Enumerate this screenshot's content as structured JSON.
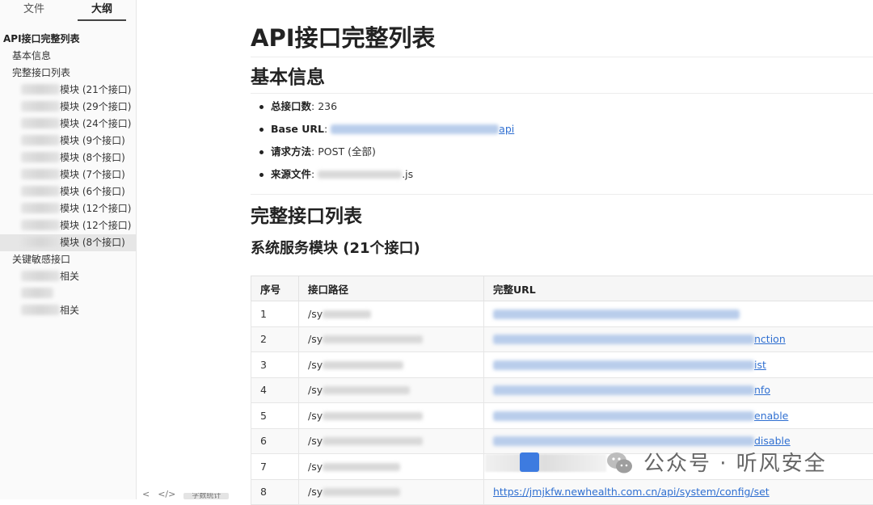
{
  "sidebar": {
    "tabs": [
      {
        "label": "文件"
      },
      {
        "label": "大纲"
      }
    ],
    "outline": {
      "title": "API接口完整列表",
      "items": [
        {
          "label": "基本信息"
        },
        {
          "label": "完整接口列表"
        }
      ],
      "modules": [
        {
          "label": "模块 (21个接口)"
        },
        {
          "label": "模块 (29个接口)"
        },
        {
          "label": "模块 (24个接口)"
        },
        {
          "label": "模块 (9个接口)"
        },
        {
          "label": "模块 (8个接口)"
        },
        {
          "label": "模块 (7个接口)"
        },
        {
          "label": "模块 (6个接口)"
        },
        {
          "label": "模块 (12个接口)"
        },
        {
          "label": "模块 (12个接口)"
        },
        {
          "label": "模块 (8个接口)"
        }
      ],
      "sensitive": {
        "label": "关键敏感接口",
        "children": [
          {
            "label": "相关"
          },
          {
            "label": ""
          },
          {
            "label": "相关"
          }
        ]
      }
    }
  },
  "main": {
    "title": "API接口完整列表",
    "basic": {
      "heading": "基本信息",
      "total_key": "总接口数",
      "total_value": ": 236",
      "base_url_key": "Base URL",
      "base_url_sep": ": ",
      "base_url_tail": "api",
      "method_key": "请求方法",
      "method_value": ": POST (全部)",
      "source_key": "来源文件",
      "source_sep": ": ",
      "source_tail": ".js"
    },
    "list_heading": "完整接口列表",
    "module_heading": "系统服务模块 (21个接口)",
    "table": {
      "headers": [
        "序号",
        "接口路径",
        "完整URL"
      ],
      "rows": [
        {
          "num": "1",
          "path": "/sy",
          "url": ""
        },
        {
          "num": "2",
          "path": "/sy",
          "url": "nction"
        },
        {
          "num": "3",
          "path": "/sy",
          "url": "ist"
        },
        {
          "num": "4",
          "path": "/sy",
          "url": "nfo"
        },
        {
          "num": "5",
          "path": "/sy",
          "url": "enable"
        },
        {
          "num": "6",
          "path": "/sy",
          "url": "disable"
        },
        {
          "num": "7",
          "path": "/sy",
          "url": ""
        },
        {
          "num": "8",
          "path": "/sy",
          "url": "https://jmjkfw.newhealth.com.cn/api/system/config/set"
        }
      ]
    }
  },
  "watermark": {
    "text": "公众号 · 听风安全"
  },
  "bottom_bar": {
    "back": "<",
    "code": "</>",
    "status": "字数统计"
  }
}
